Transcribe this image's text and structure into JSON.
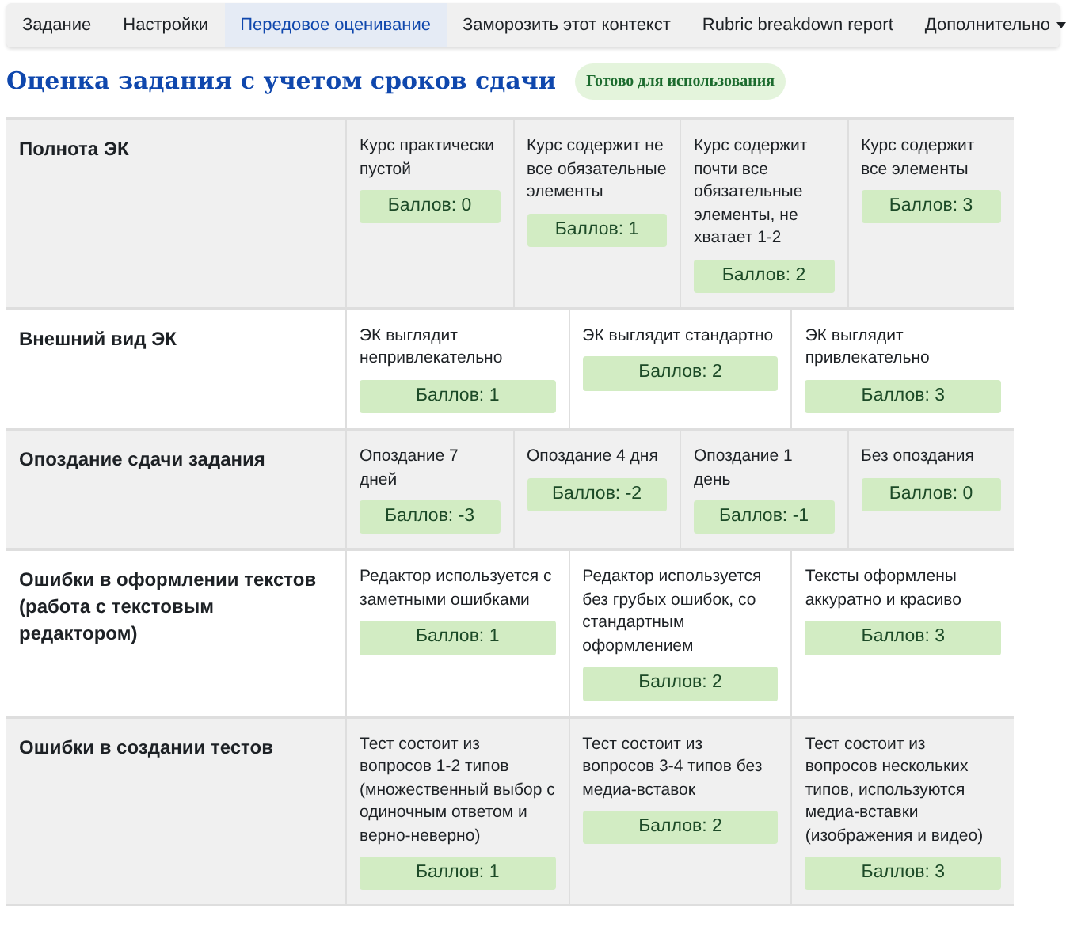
{
  "tabs": [
    {
      "label": "Задание",
      "selected": false
    },
    {
      "label": "Настройки",
      "selected": false
    },
    {
      "label": "Передовое оценивание",
      "selected": true
    },
    {
      "label": "Заморозить этот контекст",
      "selected": false
    },
    {
      "label": "Rubric breakdown report",
      "selected": false
    },
    {
      "label": "Дополнительно",
      "selected": false,
      "kind": "dropdown"
    }
  ],
  "title": "Оценка задания с учетом сроков сдачи",
  "status_badge": "Готово для использования",
  "rubric": [
    {
      "criterion": "Полнота ЭК",
      "levels": [
        {
          "text": "Курс практически пустой",
          "score": "Баллов: 0"
        },
        {
          "text": "Курс содержит не все обязательные элементы",
          "score": "Баллов: 1"
        },
        {
          "text": "Курс содержит почти все обязательные элементы, не хватает 1-2",
          "score": "Баллов: 2"
        },
        {
          "text": "Курс содержит все элементы",
          "score": "Баллов: 3"
        }
      ]
    },
    {
      "criterion": "Внешний вид ЭК",
      "levels": [
        {
          "text": "ЭК выглядит непривлекательно",
          "score": "Баллов: 1"
        },
        {
          "text": "ЭК выглядит стандартно",
          "score": "Баллов: 2"
        },
        {
          "text": "ЭК выглядит привлекательно",
          "score": "Баллов: 3"
        }
      ]
    },
    {
      "criterion": "Опоздание сдачи задания",
      "levels": [
        {
          "text": "Опоздание 7 дней",
          "score": "Баллов: -3"
        },
        {
          "text": "Опоздание 4 дня",
          "score": "Баллов: -2"
        },
        {
          "text": "Опоздание 1 день",
          "score": "Баллов: -1"
        },
        {
          "text": "Без опоздания",
          "score": "Баллов: 0"
        }
      ]
    },
    {
      "criterion": "Ошибки в оформлении текстов (работа с текстовым редактором)",
      "levels": [
        {
          "text": "Редактор используется с заметными ошибками",
          "score": "Баллов: 1"
        },
        {
          "text": "Редактор используется без грубых ошибок, со стандартным оформлением",
          "score": "Баллов: 2"
        },
        {
          "text": "Тексты оформлены аккуратно и красиво",
          "score": "Баллов: 3"
        }
      ]
    },
    {
      "criterion": "Ошибки в создании тестов",
      "levels": [
        {
          "text": "Тест состоит из вопросов 1-2 типов (множественный выбор с одиночным ответом и верно-неверно)",
          "score": "Баллов: 1"
        },
        {
          "text": "Тест состоит из вопросов 3-4 типов без медиа-вставок",
          "score": "Баллов: 2"
        },
        {
          "text": "Тест состоит из вопросов нескольких типов, используются медиа-вставки (изображения и видео)",
          "score": "Баллов: 3"
        }
      ]
    }
  ]
}
